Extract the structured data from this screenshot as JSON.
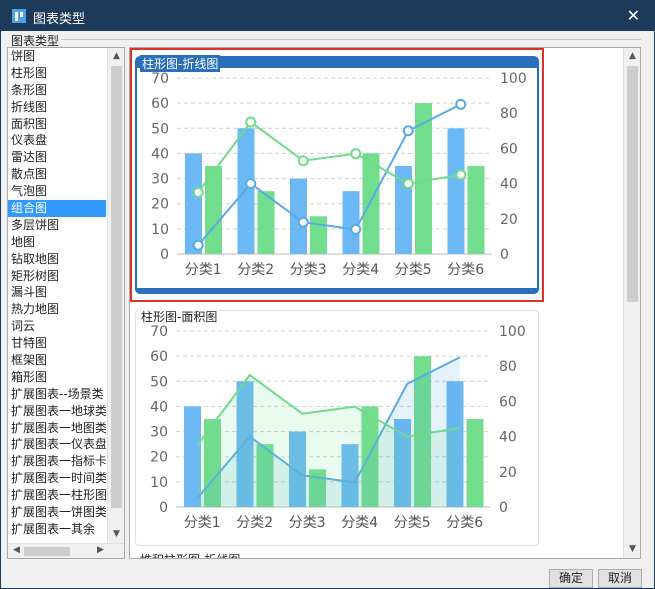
{
  "window": {
    "title": "图表类型",
    "close_glyph": "✕"
  },
  "group_label": "图表类型",
  "chart_types": [
    "饼图",
    "柱形图",
    "条形图",
    "折线图",
    "面积图",
    "仪表盘",
    "雷达图",
    "散点图",
    "气泡图",
    "组合图",
    "多层饼图",
    "地图",
    "钻取地图",
    "矩形树图",
    "漏斗图",
    "热力地图",
    "词云",
    "甘特图",
    "框架图",
    "箱形图",
    "扩展图表--场景类",
    "扩展图表一地球类",
    "扩展图表一地图类",
    "扩展图表一仪表盘",
    "扩展图表一指标卡",
    "扩展图表一时间类",
    "扩展图表一柱形图",
    "扩展图表一饼图类",
    "扩展图表一其余"
  ],
  "selected_index": 9,
  "previews": [
    {
      "title": "柱形图-折线图"
    },
    {
      "title": "柱形图-面积图"
    },
    {
      "title": "堆积柱形图-折线图"
    }
  ],
  "colors": {
    "bar_blue": "#6cb8f5",
    "bar_green": "#72dd8c",
    "line_blue": "#5aaae6",
    "line_green": "#6ddc8a",
    "accent": "#2a6fba",
    "highlight": "#e0302a"
  },
  "chart_data": [
    {
      "type": "bar+line",
      "categories": [
        "分类1",
        "分类2",
        "分类3",
        "分类4",
        "分类5",
        "分类6"
      ],
      "left_axis": {
        "ylim": [
          0,
          70
        ],
        "ticks": [
          0,
          10,
          20,
          30,
          40,
          50,
          60,
          70
        ]
      },
      "right_axis": {
        "ylim": [
          0,
          100
        ],
        "ticks": [
          0,
          20,
          40,
          60,
          80,
          100
        ]
      },
      "bar_series": [
        {
          "values": [
            40,
            50,
            30,
            25,
            35,
            50
          ]
        },
        {
          "values": [
            35,
            25,
            15,
            40,
            60,
            35
          ]
        }
      ],
      "line_series": [
        {
          "values": [
            5,
            40,
            18,
            14,
            70,
            85
          ]
        },
        {
          "values": [
            35,
            75,
            53,
            57,
            40,
            45
          ]
        }
      ]
    },
    {
      "type": "bar+area",
      "categories": [
        "分类1",
        "分类2",
        "分类3",
        "分类4",
        "分类5",
        "分类6"
      ],
      "left_axis": {
        "ylim": [
          0,
          70
        ],
        "ticks": [
          0,
          10,
          20,
          30,
          40,
          50,
          60,
          70
        ]
      },
      "right_axis": {
        "ylim": [
          0,
          100
        ],
        "ticks": [
          0,
          20,
          40,
          60,
          80,
          100
        ]
      },
      "bar_series": [
        {
          "values": [
            40,
            50,
            30,
            25,
            35,
            50
          ]
        },
        {
          "values": [
            35,
            25,
            15,
            40,
            60,
            35
          ]
        }
      ],
      "line_series": [
        {
          "values": [
            5,
            40,
            18,
            14,
            70,
            85
          ]
        },
        {
          "values": [
            35,
            75,
            53,
            57,
            40,
            45
          ]
        }
      ]
    }
  ],
  "buttons": {
    "ok": "确定",
    "cancel": "取消"
  },
  "scroll_arrows": {
    "up": "▲",
    "down": "▼",
    "left": "◀",
    "right": "▶"
  }
}
